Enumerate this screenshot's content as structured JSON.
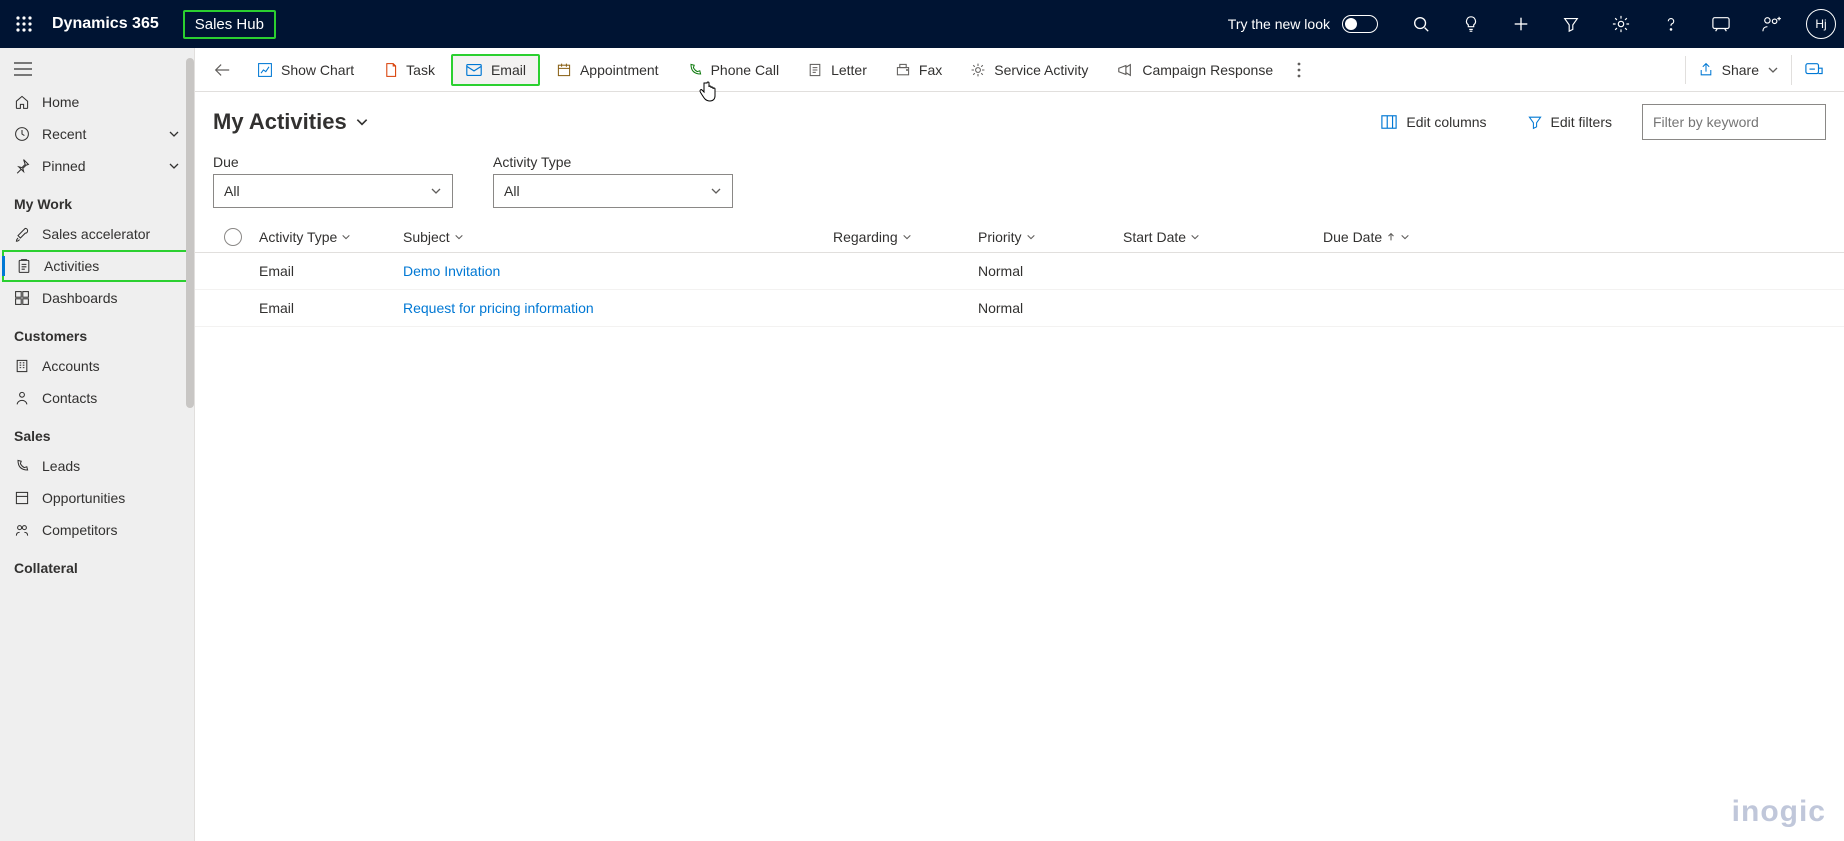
{
  "topbar": {
    "brand": "Dynamics 365",
    "app": "Sales Hub",
    "try": "Try the new look",
    "avatar": "Hj"
  },
  "sidebar": {
    "items_top": [
      {
        "label": "Home"
      },
      {
        "label": "Recent"
      },
      {
        "label": "Pinned"
      }
    ],
    "section_mywork": "My Work",
    "mywork": [
      {
        "label": "Sales accelerator"
      },
      {
        "label": "Activities"
      },
      {
        "label": "Dashboards"
      }
    ],
    "section_customers": "Customers",
    "customers": [
      {
        "label": "Accounts"
      },
      {
        "label": "Contacts"
      }
    ],
    "section_sales": "Sales",
    "sales": [
      {
        "label": "Leads"
      },
      {
        "label": "Opportunities"
      },
      {
        "label": "Competitors"
      }
    ],
    "section_collateral": "Collateral"
  },
  "cmdbar": {
    "show_chart": "Show Chart",
    "task": "Task",
    "email": "Email",
    "appointment": "Appointment",
    "phone": "Phone Call",
    "letter": "Letter",
    "fax": "Fax",
    "service": "Service Activity",
    "campaign": "Campaign Response",
    "share": "Share"
  },
  "view": {
    "title": "My Activities",
    "edit_columns": "Edit columns",
    "edit_filters": "Edit filters",
    "search_placeholder": "Filter by keyword"
  },
  "filters": {
    "due_label": "Due",
    "due_value": "All",
    "type_label": "Activity Type",
    "type_value": "All"
  },
  "columns": {
    "activity_type": "Activity Type",
    "subject": "Subject",
    "regarding": "Regarding",
    "priority": "Priority",
    "start_date": "Start Date",
    "due_date": "Due Date"
  },
  "rows": [
    {
      "activity_type": "Email",
      "subject": "Demo Invitation",
      "regarding": "",
      "priority": "Normal",
      "start_date": "",
      "due_date": ""
    },
    {
      "activity_type": "Email",
      "subject": "Request for pricing information",
      "regarding": "",
      "priority": "Normal",
      "start_date": "",
      "due_date": ""
    }
  ],
  "watermark": "inogic"
}
